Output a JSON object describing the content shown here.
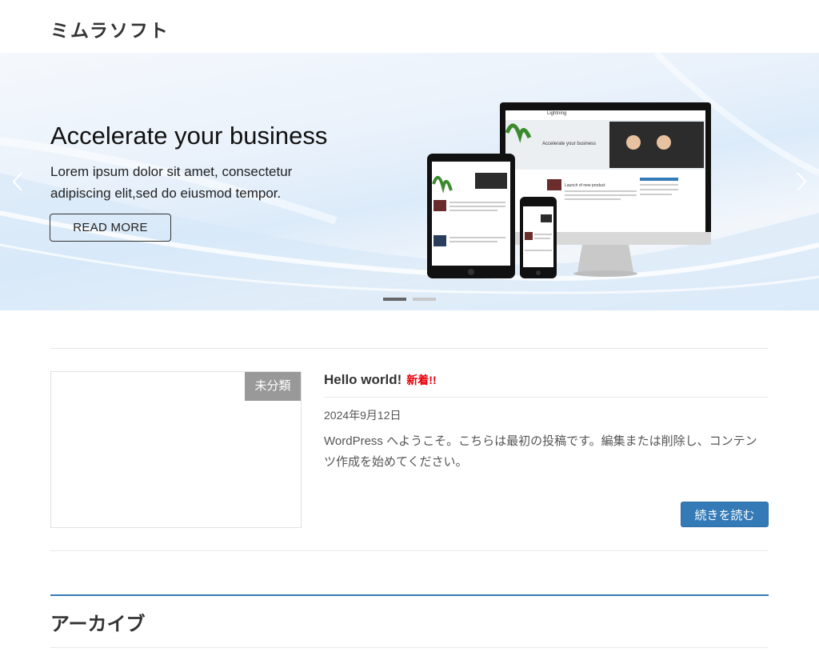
{
  "site": {
    "title": "ミムラソフト"
  },
  "hero": {
    "title": "Accelerate your business",
    "text": "Lorem ipsum dolor sit amet, consectetur adipiscing elit,sed do eiusmod tempor.",
    "button_label": "READ MORE",
    "active_slide": 1,
    "slide_count": 2,
    "mockup": {
      "brand": "Lightning",
      "headline": "Accelerate your business",
      "post_heading": "Launch of new product"
    }
  },
  "post": {
    "category": "未分類",
    "title": "Hello world!",
    "new_label": "新着!!",
    "date": "2024年9月12日",
    "excerpt": "WordPress へようこそ。こちらは最初の投稿です。編集または削除し、コンテンツ作成を始めてください。",
    "more_label": "続きを読む"
  },
  "archive": {
    "title": "アーカイブ"
  },
  "colors": {
    "accent": "#337ab7",
    "new_label": "#e8000b",
    "badge": "#999999"
  }
}
